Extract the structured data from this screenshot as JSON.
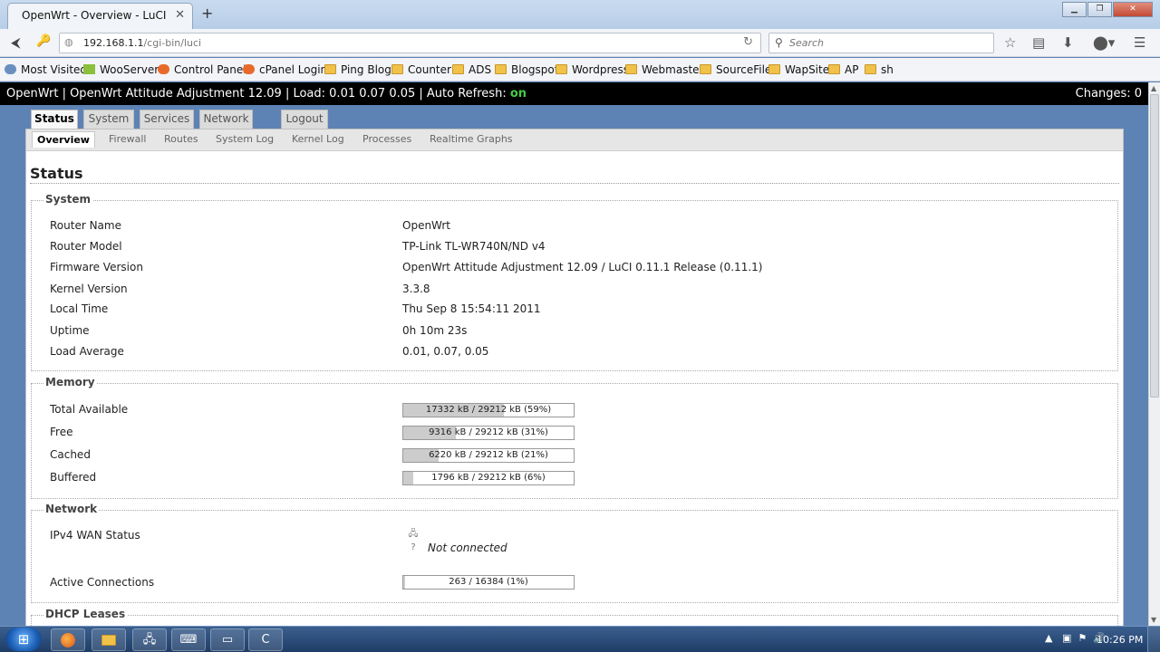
{
  "browser": {
    "tab_title": "OpenWrt - Overview - LuCI",
    "url_host": "192.168.1.1",
    "url_path": "/cgi-bin/luci",
    "search_placeholder": "Search",
    "bookmarks": [
      {
        "label": "Most Visited",
        "icon": "gear-icon"
      },
      {
        "label": "WooServers",
        "icon": "woo-favicon"
      },
      {
        "label": "Control Panel",
        "icon": "cpanel-icon"
      },
      {
        "label": "cPanel Login",
        "icon": "cpanel-icon"
      },
      {
        "label": "Ping Blog",
        "icon": "folder-icon"
      },
      {
        "label": "Counter",
        "icon": "folder-icon"
      },
      {
        "label": "ADS",
        "icon": "folder-icon"
      },
      {
        "label": "Blogspot",
        "icon": "folder-icon"
      },
      {
        "label": "Wordpress",
        "icon": "folder-icon"
      },
      {
        "label": "Webmaster",
        "icon": "folder-icon"
      },
      {
        "label": "SourceFile",
        "icon": "folder-icon"
      },
      {
        "label": "WapSite",
        "icon": "folder-icon"
      },
      {
        "label": "AP",
        "icon": "folder-icon"
      },
      {
        "label": "sh",
        "icon": "folder-icon"
      }
    ]
  },
  "header": {
    "title": "OpenWrt | OpenWrt Attitude Adjustment 12.09 | Load: 0.01 0.07 0.05 | Auto Refresh:",
    "refresh_state": "on",
    "changes": "Changes: 0"
  },
  "main_tabs": [
    "Status",
    "System",
    "Services",
    "Network",
    "Logout"
  ],
  "sub_tabs": [
    "Overview",
    "Firewall",
    "Routes",
    "System Log",
    "Kernel Log",
    "Processes",
    "Realtime Graphs"
  ],
  "page_title": "Status",
  "system": {
    "legend": "System",
    "rows": [
      {
        "label": "Router Name",
        "value": "OpenWrt"
      },
      {
        "label": "Router Model",
        "value": "TP-Link TL-WR740N/ND v4"
      },
      {
        "label": "Firmware Version",
        "value": "OpenWrt Attitude Adjustment 12.09 / LuCI 0.11.1 Release (0.11.1)"
      },
      {
        "label": "Kernel Version",
        "value": "3.3.8"
      },
      {
        "label": "Local Time",
        "value": "Thu Sep 8 15:54:11 2011"
      },
      {
        "label": "Uptime",
        "value": "0h 10m 23s"
      },
      {
        "label": "Load Average",
        "value": "0.01, 0.07, 0.05"
      }
    ]
  },
  "memory": {
    "legend": "Memory",
    "rows": [
      {
        "label": "Total Available",
        "text": "17332 kB / 29212 kB (59%)",
        "percent": 59
      },
      {
        "label": "Free",
        "text": "9316 kB / 29212 kB (31%)",
        "percent": 31
      },
      {
        "label": "Cached",
        "text": "6220 kB / 29212 kB (21%)",
        "percent": 21
      },
      {
        "label": "Buffered",
        "text": "1796 kB / 29212 kB (6%)",
        "percent": 6
      }
    ]
  },
  "network": {
    "legend": "Network",
    "wan_label": "IPv4 WAN Status",
    "wan_status": "Not connected",
    "connections_label": "Active Connections",
    "connections_text": "263 / 16384 (1%)",
    "connections_percent": 1
  },
  "dhcp": {
    "legend": "DHCP Leases"
  },
  "taskbar": {
    "clock": "10:26 PM",
    "apps": [
      "firefox-icon",
      "explorer-icon",
      "network-icon",
      "putty-icon",
      "notepad-icon",
      "ccleaner-icon"
    ]
  }
}
